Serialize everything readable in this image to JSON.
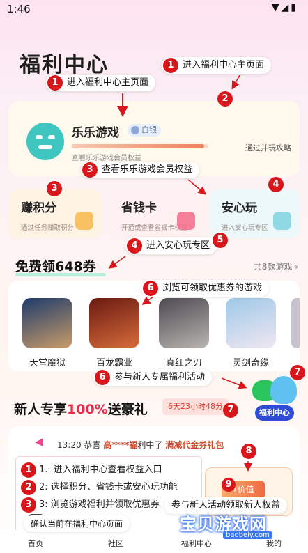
{
  "status": {
    "time": "1:46"
  },
  "page_title": "福利中心",
  "annotations": [
    {
      "num": "1",
      "text": "进入福利中心主页面"
    },
    {
      "num": "1",
      "text": "进入福利中心主页面"
    },
    {
      "num": "2",
      "text": ""
    },
    {
      "num": "3",
      "text": "查看乐乐游戏会员权益"
    },
    {
      "num": "3",
      "text": ""
    },
    {
      "num": "4",
      "text": ""
    },
    {
      "num": "4",
      "text": "进入安心玩专区"
    },
    {
      "num": "5",
      "text": ""
    },
    {
      "num": "6",
      "text": "浏览可领取优惠券的游戏"
    },
    {
      "num": "6",
      "text": "参与新人专属福利活动"
    },
    {
      "num": "7",
      "text": ""
    },
    {
      "num": "7",
      "text": ""
    },
    {
      "num": "8",
      "text": ""
    },
    {
      "num": "9",
      "text": ""
    }
  ],
  "member": {
    "app_name": "乐乐游戏",
    "level": "白银",
    "hint": "查看乐乐游戏会员权益",
    "strategy": "通过并玩攻略",
    "progress": 0.97
  },
  "features": [
    {
      "title": "赚积分",
      "sub": "通过任务赚取积分",
      "color": "#f7b84b",
      "bg": "#fff3e4"
    },
    {
      "title": "省钱卡",
      "sub": "开通或查看省钱卡权益",
      "color": "#f36b8a",
      "bg": "#fff0f2"
    },
    {
      "title": "安心玩",
      "sub": "进入安心玩专区",
      "color": "#7ed3de",
      "bg": "#ecf8fa"
    }
  ],
  "coupon_section": {
    "title": "免费领648券",
    "more": "共8款游戏 ›"
  },
  "games": [
    {
      "name": "天堂魔狱",
      "colors": [
        "#1f3b6b",
        "#c99c6a"
      ]
    },
    {
      "name": "百龙霸业",
      "colors": [
        "#6a1a12",
        "#d76c3a"
      ]
    },
    {
      "name": "真红之刃",
      "colors": [
        "#4e4a52",
        "#b9b5b0"
      ]
    },
    {
      "name": "灵剑奇缘",
      "colors": [
        "#9ec9e8",
        "#f0e7f1"
      ]
    }
  ],
  "new_user": {
    "title_prefix": "新人专享",
    "title_highlight": "100%",
    "title_suffix": "送豪礼",
    "countdown": "6天23小时48分",
    "mascot_label": "福利中心"
  },
  "notice": {
    "time": "13:20",
    "prefix": "恭喜",
    "user": "高****福",
    "middle": "利中了",
    "prize": "满减代金券礼包"
  },
  "legend": [
    {
      "num": "1",
      "text": "1.· 进入福利中心查看权益入口"
    },
    {
      "num": "2",
      "text": "2: 选择积分、省钱卡或安心玩功能"
    },
    {
      "num": "3",
      "text": "3: 浏览游戏福利并领取优惠券"
    }
  ],
  "reward": {
    "chip": "1价值"
  },
  "join_pill": "参与新人活动领取新人权益",
  "confirm_pill": "确认当前在福利中心页面",
  "tabs": [
    {
      "label": "首页"
    },
    {
      "label": "社区"
    },
    {
      "label": "福利中心"
    },
    {
      "label": "我的"
    }
  ],
  "watermark": {
    "text": "宝贝游戏网",
    "url": "baobeiy.com"
  }
}
